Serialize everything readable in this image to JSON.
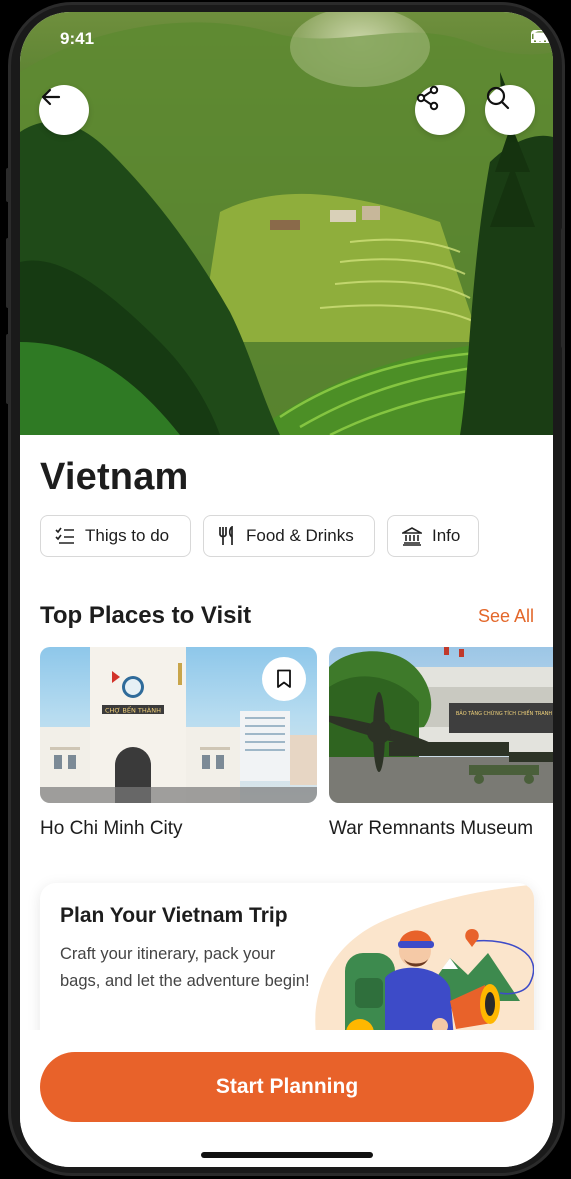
{
  "status_bar": {
    "time": "9:41"
  },
  "header": {
    "title": "Vietnam"
  },
  "categories": [
    {
      "label": "Thigs to do",
      "icon": "checklist-icon"
    },
    {
      "label": "Food & Drinks",
      "icon": "fork-knife-icon"
    },
    {
      "label": "Info",
      "icon": "museum-icon"
    }
  ],
  "top_places": {
    "title": "Top Places to Visit",
    "see_all": "See All",
    "items": [
      {
        "name": "Ho Chi Minh City",
        "sign": "CHỢ BẾN THÀNH"
      },
      {
        "name": "War Remnants Museum",
        "sign": "BẢO TÀNG CHỨNG TÍCH CHIẾN TRANH"
      }
    ]
  },
  "plan_card": {
    "title": "Plan Your Vietnam Trip",
    "description": "Craft your itinerary, pack your bags, and let the adventure begin!"
  },
  "cta": {
    "label": "Start Planning"
  },
  "colors": {
    "accent": "#E8622A",
    "text": "#1D1D1D",
    "chip_border": "#D8D8D8"
  }
}
